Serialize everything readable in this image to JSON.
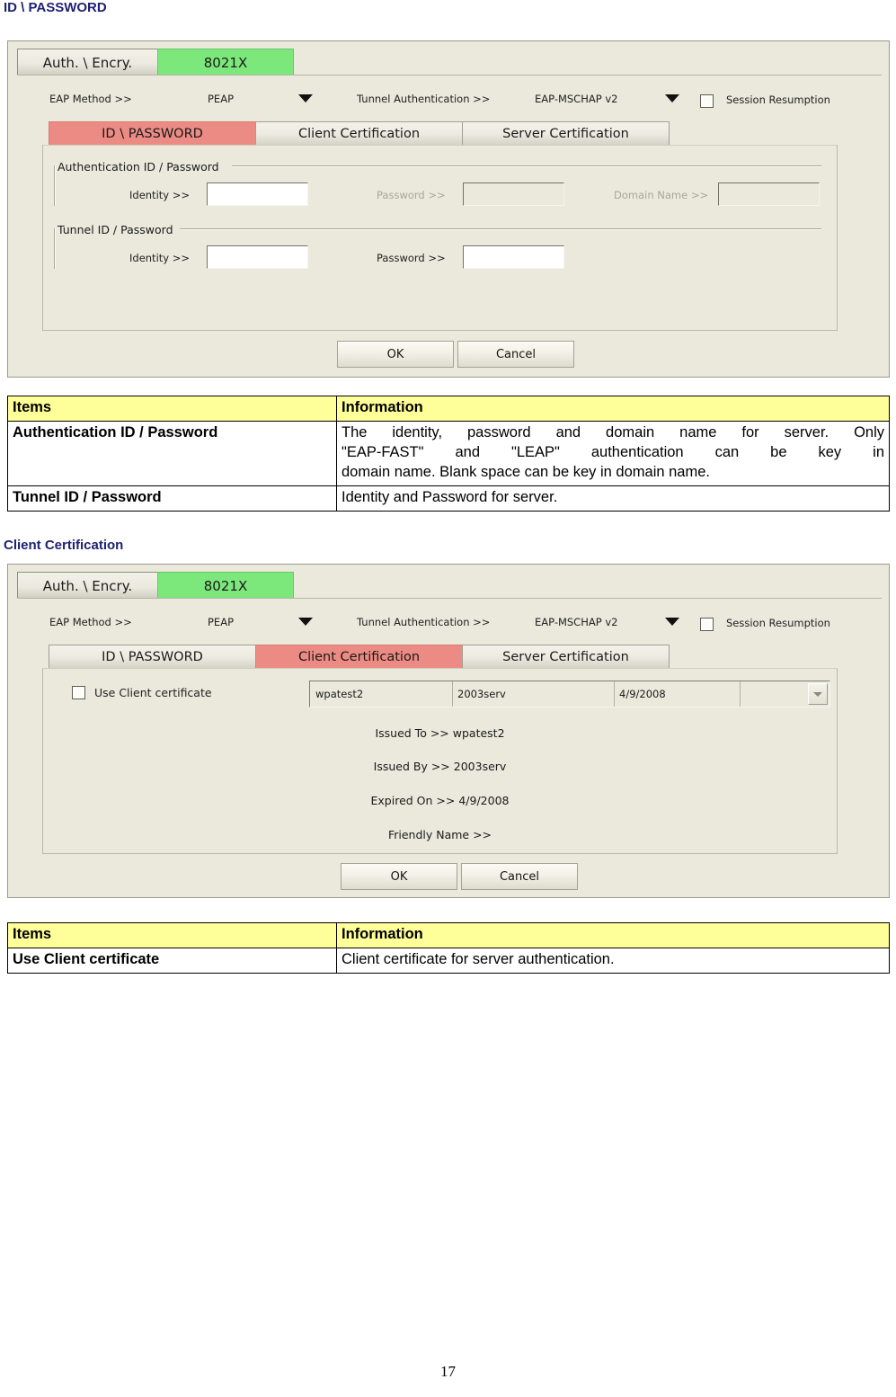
{
  "page": {
    "number": "17"
  },
  "sections": [
    {
      "heading": "ID \\ PASSWORD",
      "dialog": {
        "top_tabs": [
          {
            "label": "Auth. \\ Encry.",
            "state": "inactive"
          },
          {
            "label": "8021X",
            "state": "active"
          }
        ],
        "eap": {
          "method_label": "EAP Method >>",
          "method_value": "PEAP",
          "tunnel_label": "Tunnel Authentication >>",
          "tunnel_value": "EAP-MSCHAP v2",
          "session_resumption_label": "Session Resumption",
          "session_resumption_checked": false
        },
        "inner_tabs": [
          {
            "label": "ID \\ PASSWORD",
            "state": "active"
          },
          {
            "label": "Client Certification",
            "state": "inactive"
          },
          {
            "label": "Server Certification",
            "state": "inactive"
          }
        ],
        "groups": [
          {
            "title": "Authentication ID / Password",
            "fields": [
              {
                "label": "Identity >>",
                "value": "",
                "disabled": false
              },
              {
                "label": "Password >>",
                "value": "",
                "disabled": true
              },
              {
                "label": "Domain Name >>",
                "value": "",
                "disabled": true
              }
            ]
          },
          {
            "title": "Tunnel ID / Password",
            "fields": [
              {
                "label": "Identity >>",
                "value": "",
                "disabled": false
              },
              {
                "label": "Password >>",
                "value": "",
                "disabled": false
              }
            ]
          }
        ],
        "buttons": [
          {
            "label": "OK"
          },
          {
            "label": "Cancel"
          }
        ]
      },
      "table": {
        "headers": [
          "Items",
          "Information"
        ],
        "rows": [
          {
            "item": "Authentication ID /  Password",
            "info_line1": "The identity, password and domain name for server. Only",
            "info_line2": "\"EAP-FAST\" and \"LEAP\" authentication can be key in",
            "info_line3": "domain name. Blank space can be key in domain name."
          },
          {
            "item": "Tunnel ID /  Password",
            "info_line1": "Identity and Password for server."
          }
        ]
      }
    },
    {
      "heading": "Client Certification",
      "dialog": {
        "top_tabs": [
          {
            "label": "Auth. \\ Encry.",
            "state": "inactive"
          },
          {
            "label": "8021X",
            "state": "active"
          }
        ],
        "eap": {
          "method_label": "EAP Method >>",
          "method_value": "PEAP",
          "tunnel_label": "Tunnel Authentication >>",
          "tunnel_value": "EAP-MSCHAP v2",
          "session_resumption_label": "Session Resumption",
          "session_resumption_checked": false
        },
        "inner_tabs": [
          {
            "label": "ID \\ PASSWORD",
            "state": "inactive"
          },
          {
            "label": "Client Certification",
            "state": "active"
          },
          {
            "label": "Server Certification",
            "state": "inactive"
          }
        ],
        "use_client_cert": {
          "label": "Use Client certificate",
          "checked": false
        },
        "cert_combo": {
          "columns": [
            "wpatest2",
            "2003serv",
            "4/9/2008",
            ""
          ]
        },
        "cert_details": [
          {
            "label": "Issued To >>",
            "value": "wpatest2"
          },
          {
            "label": "Issued By >>",
            "value": "2003serv"
          },
          {
            "label": "Expired On >>",
            "value": "4/9/2008"
          },
          {
            "label": "Friendly Name >>",
            "value": ""
          }
        ],
        "buttons": [
          {
            "label": "OK"
          },
          {
            "label": "Cancel"
          }
        ]
      },
      "table": {
        "headers": [
          "Items",
          "Information"
        ],
        "rows": [
          {
            "item": "Use Client certificate",
            "info_line1": "Client certificate for server authentication."
          }
        ]
      }
    }
  ],
  "colors": {
    "heading": "#1f2270",
    "dialog_face": "#eae9dc",
    "tab_active_green": "#7ce87c",
    "tab_active_red": "#ec8b84",
    "table_header": "#ffff99"
  }
}
